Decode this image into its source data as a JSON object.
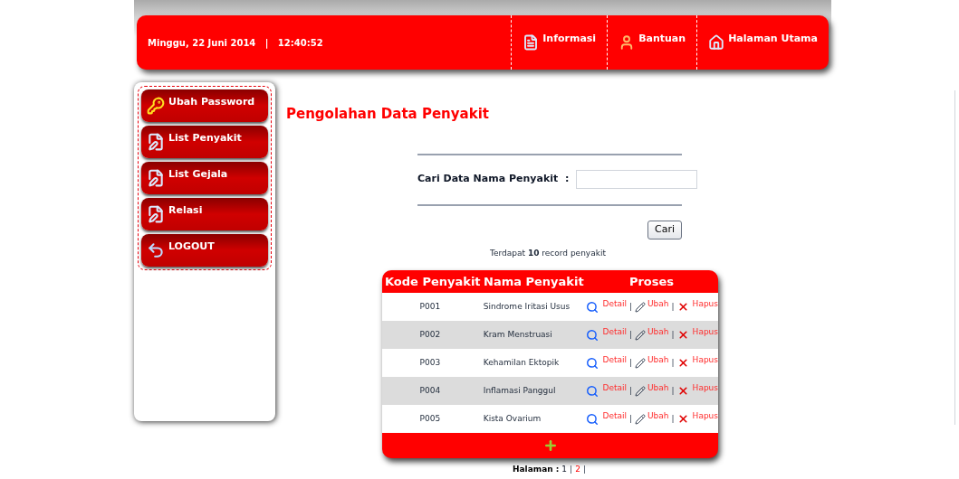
{
  "header": {
    "datetime": "Minggu, 22 Juni 2014   |   12:40:52",
    "nav": [
      {
        "label": "Informasi",
        "kind": "info"
      },
      {
        "label": "Bantuan",
        "kind": "help"
      },
      {
        "label": "Halaman Utama",
        "kind": "home"
      }
    ]
  },
  "sidebar": {
    "items": [
      {
        "label": "Ubah Password",
        "kind": "key"
      },
      {
        "label": "List Penyakit",
        "kind": "edit"
      },
      {
        "label": "List Gejala",
        "kind": "edit"
      },
      {
        "label": "Relasi",
        "kind": "edit"
      },
      {
        "label": "LOGOUT",
        "kind": "back"
      }
    ]
  },
  "page_title": "Pengolahan Data Penyakit",
  "search": {
    "label": "Cari Data Nama Penyakit  :",
    "button": "Cari"
  },
  "record_count": "Terdapat **10** record penyakit",
  "table": {
    "separator": "|",
    "columns": [
      "Kode Penyakit",
      "Nama Penyakit",
      "Proses"
    ],
    "rows": [
      {
        "kode": "P001",
        "nama": "Sindrome Iritasi Usus",
        "actions": [
          "Detail",
          "Ubah",
          "Hapus"
        ]
      },
      {
        "kode": "P002",
        "nama": "Kram Menstruasi",
        "actions": [
          "Detail",
          "Ubah",
          "Hapus"
        ]
      },
      {
        "kode": "P003",
        "nama": "Kehamilan Ektopik",
        "actions": [
          "Detail",
          "Ubah",
          "Hapus"
        ]
      },
      {
        "kode": "P004",
        "nama": "Inflamasi Panggul",
        "actions": [
          "Detail",
          "Ubah",
          "Hapus"
        ]
      },
      {
        "kode": "P005",
        "nama": "Kista Ovarium",
        "actions": [
          "Detail",
          "Ubah",
          "Hapus"
        ]
      }
    ]
  },
  "pagination": {
    "label": "Halaman :",
    "separator": "|",
    "pages": [
      {
        "label": "1",
        "selected": true
      },
      {
        "label": "2",
        "selected": false
      }
    ]
  }
}
